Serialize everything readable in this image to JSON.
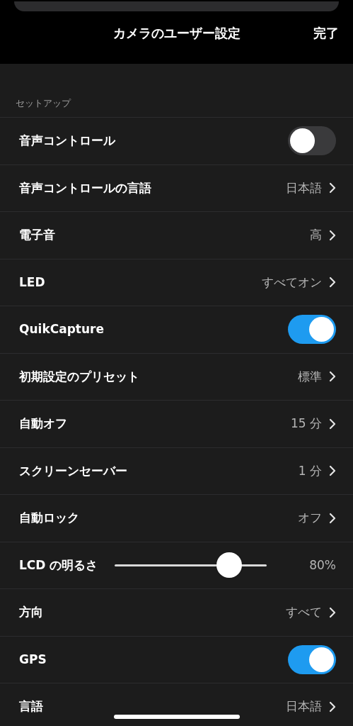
{
  "header": {
    "title": "カメラのユーザー設定",
    "done": "完了"
  },
  "section": {
    "title": "セットアップ"
  },
  "rows": [
    {
      "kind": "toggle",
      "label": "音声コントロール",
      "on": false
    },
    {
      "kind": "value",
      "label": "音声コントロールの言語",
      "value": "日本語"
    },
    {
      "kind": "value",
      "label": "電子音",
      "value": "高"
    },
    {
      "kind": "value",
      "label": "LED",
      "value": "すべてオン"
    },
    {
      "kind": "toggle",
      "label": "QuikCapture",
      "on": true
    },
    {
      "kind": "value",
      "label": "初期設定のプリセット",
      "value": "標準"
    },
    {
      "kind": "value",
      "label": "自動オフ",
      "value": "15 分"
    },
    {
      "kind": "value",
      "label": "スクリーンセーバー",
      "value": "1 分"
    },
    {
      "kind": "value",
      "label": "自動ロック",
      "value": "オフ"
    },
    {
      "kind": "slider",
      "label": "LCD の明るさ",
      "level": 0.8,
      "reading": "80%"
    },
    {
      "kind": "value",
      "label": "方向",
      "value": "すべて"
    },
    {
      "kind": "toggle",
      "label": "GPS",
      "on": true
    },
    {
      "kind": "value",
      "label": "言語",
      "value": "日本語"
    }
  ]
}
